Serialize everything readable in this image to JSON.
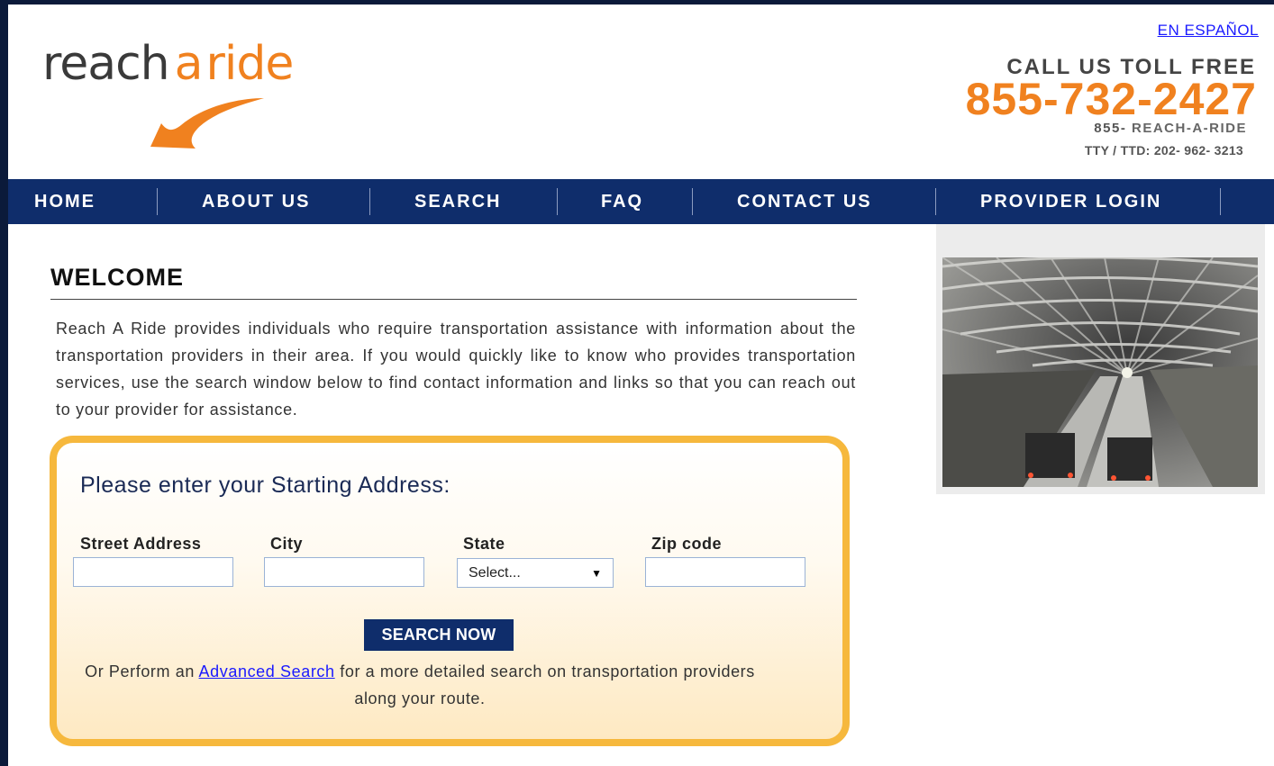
{
  "header": {
    "logo": {
      "part1": "reach",
      "part2": "a",
      "part3": "ride"
    },
    "espanol_link": "EN ESPAÑOL",
    "toll_free_label": "CALL US TOLL FREE",
    "phone_number": "855-732-2427",
    "vanity_lead": "855-",
    "vanity_number": " REACH-A-RIDE",
    "tty": "TTY / TTD: 202- 962- 3213"
  },
  "nav": {
    "items": [
      {
        "label": "HOME"
      },
      {
        "label": "ABOUT US"
      },
      {
        "label": "SEARCH"
      },
      {
        "label": "FAQ"
      },
      {
        "label": "CONTACT US"
      },
      {
        "label": "PROVIDER LOGIN"
      }
    ]
  },
  "main": {
    "title": "WELCOME",
    "intro": "Reach A Ride provides individuals who require transportation assistance with information about the transportation providers in their area. If you would quickly like to know who provides transportation services, use the search window below to find contact information and links so that you can reach out to your provider for assistance."
  },
  "search": {
    "title": "Please enter your Starting Address:",
    "street_label": "Street Address",
    "city_label": "City",
    "state_label": "State",
    "zip_label": "Zip code",
    "street_value": "",
    "city_value": "",
    "zip_value": "",
    "state_selected": "Select...",
    "button_label": "SEARCH NOW",
    "advanced_pre": "Or Perform an ",
    "advanced_link": "Advanced Search",
    "advanced_post": " for a more detailed search on transportation providers along your route."
  },
  "colors": {
    "brand_orange": "#f0811f",
    "nav_blue": "#0f2d6b",
    "search_border": "#f6b83d"
  }
}
